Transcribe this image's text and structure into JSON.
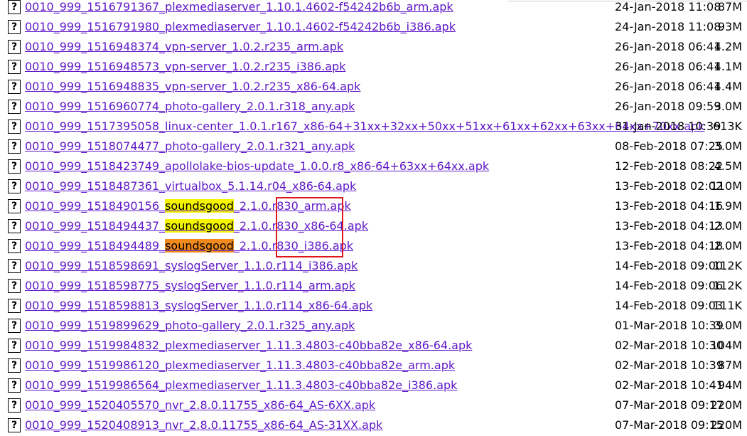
{
  "rows": [
    {
      "link": "0010_999_1516791367_plexmediaserver_1.10.1.4602-f54242b6b_arm.apk",
      "date": "24-Jan-2018 11:08",
      "size": "87M"
    },
    {
      "link": "0010_999_1516791980_plexmediaserver_1.10.1.4602-f54242b6b_i386.apk",
      "date": "24-Jan-2018 11:08",
      "size": "93M"
    },
    {
      "link": "0010_999_1516948374_vpn-server_1.0.2.r235_arm.apk",
      "date": "26-Jan-2018 06:41",
      "size": "4.2M"
    },
    {
      "link": "0010_999_1516948573_vpn-server_1.0.2.r235_i386.apk",
      "date": "26-Jan-2018 06:41",
      "size": "4.1M"
    },
    {
      "link": "0010_999_1516948835_vpn-server_1.0.2.r235_x86-64.apk",
      "date": "26-Jan-2018 06:41",
      "size": "4.4M"
    },
    {
      "link": "0010_999_1516960774_photo-gallery_2.0.1.r318_any.apk",
      "date": "26-Jan-2018 09:59",
      "size": "3.0M"
    },
    {
      "link": "0010_999_1517395058_linux-center_1.0.1.r167_x86-64+31xx+32xx+50xx+51xx+61xx+62xx+63xx+64xx+70xx.apk",
      "date": "31-Jan-2018 10:39",
      "size": "613K"
    },
    {
      "link": "0010_999_1518074477_photo-gallery_2.0.1.r321_any.apk",
      "date": "08-Feb-2018 07:25",
      "size": "3.0M"
    },
    {
      "link": "0010_999_1518423749_apollolake-bios-update_1.0.0.r8_x86-64+63xx+64xx.apk",
      "date": "12-Feb-2018 08:22",
      "size": "4.5M"
    },
    {
      "link": "0010_999_1518487361_virtualbox_5.1.14.r04_x86-64.apk",
      "date": "13-Feb-2018 02:02",
      "size": "110M"
    },
    {
      "pre": "0010_999_1518490156_",
      "hl": "soundsgood",
      "hlcolor": "y",
      "post": "_2.1.0.r830_arm.apk",
      "date": "13-Feb-2018 04:16",
      "size": "1.9M"
    },
    {
      "pre": "0010_999_1518494437_",
      "hl": "soundsgood",
      "hlcolor": "y",
      "post": "_2.1.0.r830_x86-64.apk",
      "date": "13-Feb-2018 04:13",
      "size": "2.0M"
    },
    {
      "pre": "0010_999_1518494489_",
      "hl": "soundsgood",
      "hlcolor": "o",
      "post": "_2.1.0.r830_i386.apk",
      "date": "13-Feb-2018 04:18",
      "size": "2.0M"
    },
    {
      "link": "0010_999_1518598691_syslogServer_1.1.0.r114_i386.apk",
      "date": "14-Feb-2018 09:00",
      "size": "112K"
    },
    {
      "link": "0010_999_1518598775_syslogServer_1.1.0.r114_arm.apk",
      "date": "14-Feb-2018 09:06",
      "size": "112K"
    },
    {
      "link": "0010_999_1518598813_syslogServer_1.1.0.r114_x86-64.apk",
      "date": "14-Feb-2018 09:03",
      "size": "111K"
    },
    {
      "link": "0010_999_1519899629_photo-gallery_2.0.1.r325_any.apk",
      "date": "01-Mar-2018 10:39",
      "size": "3.0M"
    },
    {
      "link": "0010_999_1519984832_plexmediaserver_1.11.3.4803-c40bba82e_x86-64.apk",
      "date": "02-Mar-2018 10:30",
      "size": "104M"
    },
    {
      "link": "0010_999_1519986120_plexmediaserver_1.11.3.4803-c40bba82e_arm.apk",
      "date": "02-Mar-2018 10:39",
      "size": "87M"
    },
    {
      "link": "0010_999_1519986564_plexmediaserver_1.11.3.4803-c40bba82e_i386.apk",
      "date": "02-Mar-2018 10:41",
      "size": "94M"
    },
    {
      "link": "0010_999_1520405570_nvr_2.8.0.11755_x86-64_AS-6XX.apk",
      "date": "07-Mar-2018 09:17",
      "size": "220M"
    },
    {
      "link": "0010_999_1520408913_nvr_2.8.0.11755_x86-64_AS-31XX.apk",
      "date": "07-Mar-2018 09:15",
      "size": "220M"
    }
  ],
  "icon_glyph": "?",
  "icon_name": "unknown-file-icon",
  "colors": {
    "link": "#5e16c8",
    "highlight_yellow": "#f5f500",
    "highlight_orange": "#f08a1c",
    "annotation_box": "#e0161d"
  }
}
